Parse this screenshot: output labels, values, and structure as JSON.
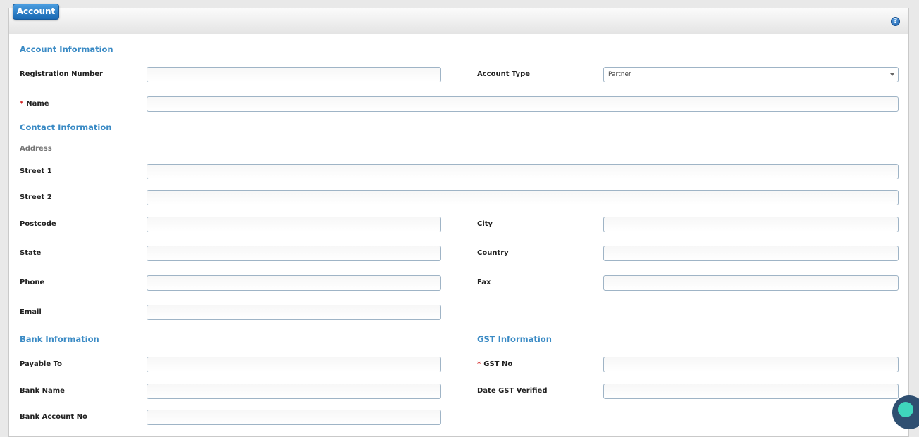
{
  "tab": {
    "label": "Account"
  },
  "help": {
    "glyph": "?"
  },
  "sections": {
    "account": "Account Information",
    "contact": "Contact Information",
    "bank": "Bank Information",
    "gst": "GST Information"
  },
  "subsections": {
    "address": "Address"
  },
  "required_mark": "*",
  "fields": {
    "registration_number": {
      "label": "Registration Number",
      "value": ""
    },
    "account_type": {
      "label": "Account Type",
      "value": "Partner"
    },
    "name": {
      "label": "Name",
      "value": ""
    },
    "street1": {
      "label": "Street 1",
      "value": ""
    },
    "street2": {
      "label": "Street 2",
      "value": ""
    },
    "postcode": {
      "label": "Postcode",
      "value": ""
    },
    "city": {
      "label": "City",
      "value": ""
    },
    "state": {
      "label": "State",
      "value": ""
    },
    "country": {
      "label": "Country",
      "value": ""
    },
    "phone": {
      "label": "Phone",
      "value": ""
    },
    "fax": {
      "label": "Fax",
      "value": ""
    },
    "email": {
      "label": "Email",
      "value": ""
    },
    "payable_to": {
      "label": "Payable To",
      "value": ""
    },
    "gst_no": {
      "label": "GST No",
      "value": ""
    },
    "bank_name": {
      "label": "Bank Name",
      "value": ""
    },
    "date_gst_verified": {
      "label": "Date GST Verified",
      "value": ""
    },
    "bank_account_no": {
      "label": "Bank Account No",
      "value": ""
    }
  },
  "colors": {
    "accent": "#3b8bc5",
    "tab_button": "#1a69b3",
    "required": "#d32323",
    "chat_bubble": "#2f4f71",
    "chat_dot": "#3fd6bd"
  },
  "icons": {
    "help": "help-icon",
    "dropdown": "chevron-down-icon",
    "chat": "chat-icon"
  }
}
